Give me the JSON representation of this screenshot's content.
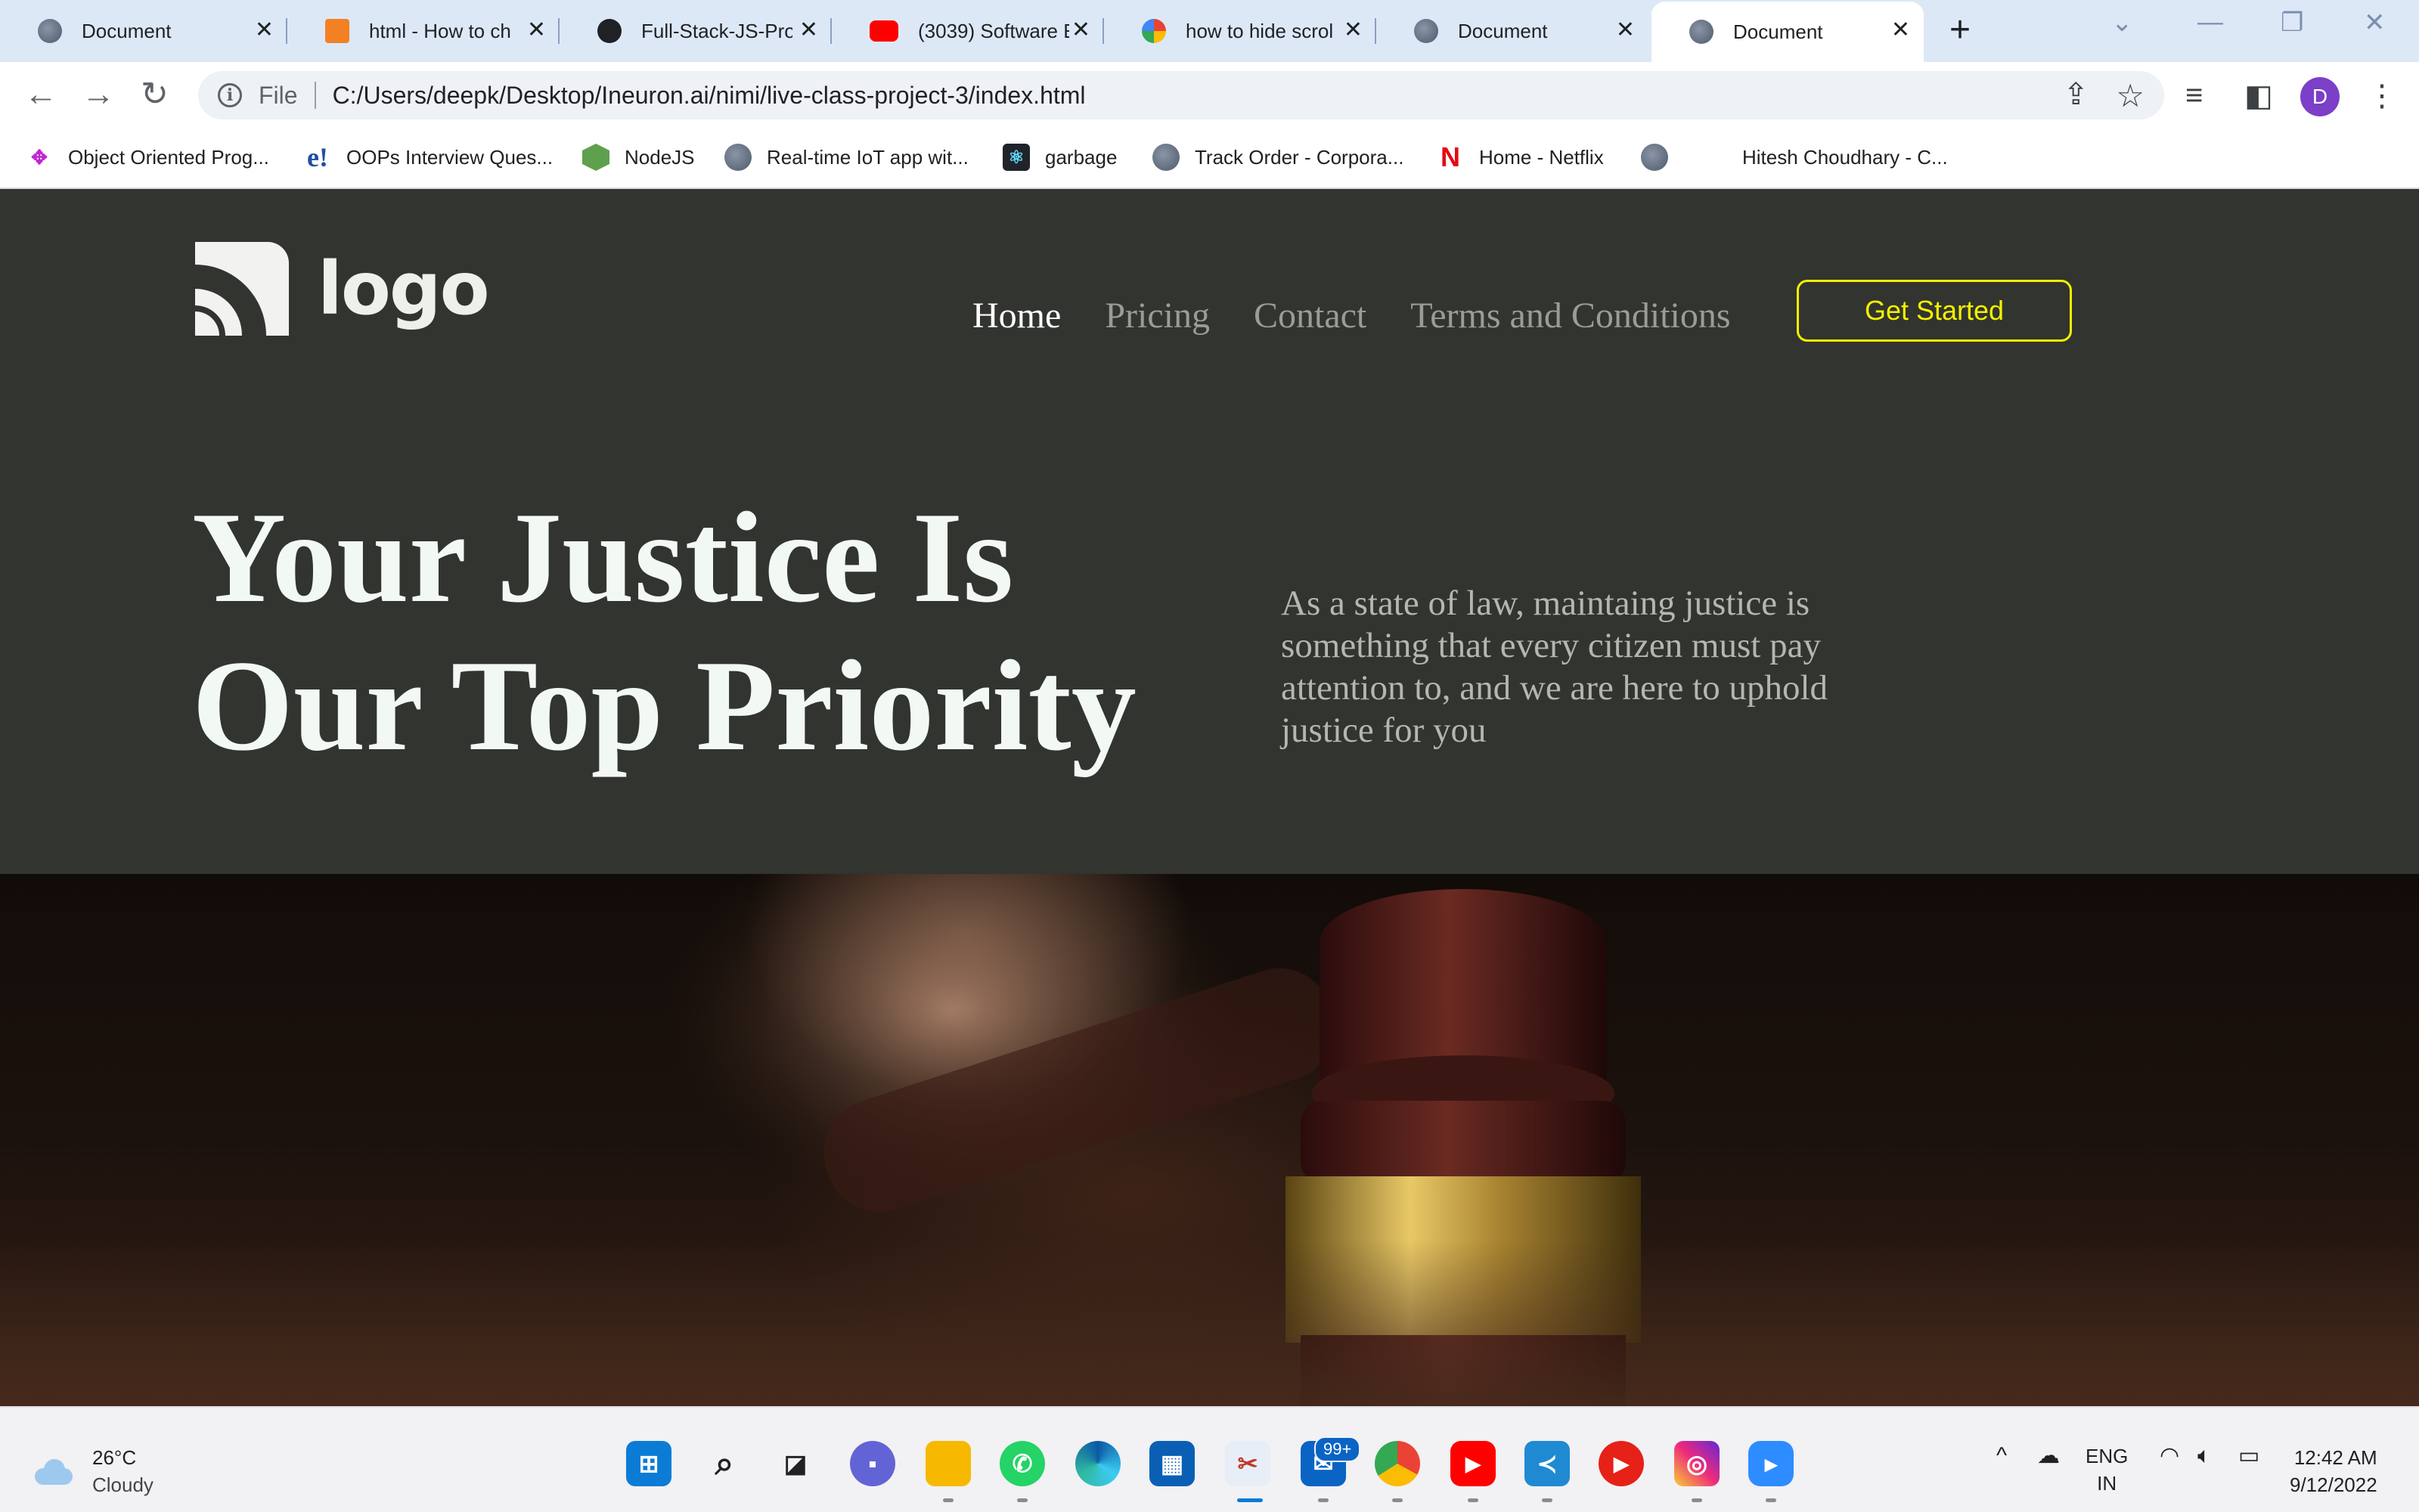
{
  "browser": {
    "tabs": [
      {
        "title": "Document",
        "icon": "globe-icon"
      },
      {
        "title": "html - How to ch",
        "icon": "stackoverflow-icon"
      },
      {
        "title": "Full-Stack-JS-Proj",
        "icon": "github-icon"
      },
      {
        "title": "(3039) Software E",
        "icon": "youtube-icon"
      },
      {
        "title": "how to hide scrol",
        "icon": "google-icon"
      },
      {
        "title": "Document",
        "icon": "globe-icon"
      },
      {
        "title": "Document",
        "icon": "globe-icon",
        "active": true
      }
    ],
    "close_glyph": "✕",
    "new_tab_glyph": "+",
    "address": {
      "scheme": "File",
      "url": "C:/Users/deepk/Desktop/Ineuron.ai/nimi/live-class-project-3/index.html"
    },
    "profile_initial": "D",
    "bookmarks": [
      {
        "label": "Object Oriented Prog...",
        "icon": "puzzle-icon"
      },
      {
        "label": "OOPs Interview Ques...",
        "icon": "e-icon"
      },
      {
        "label": "NodeJS",
        "icon": "nodejs-icon"
      },
      {
        "label": "Real-time IoT app wit...",
        "icon": "globe-icon"
      },
      {
        "label": "garbage",
        "icon": "react-icon"
      },
      {
        "label": "Track Order - Corpora...",
        "icon": "globe-icon"
      },
      {
        "label": "Home - Netflix",
        "icon": "netflix-icon"
      },
      {
        "label": "",
        "icon": "globe-icon"
      },
      {
        "label": "Hitesh Choudhary - C...",
        "icon": "none"
      }
    ]
  },
  "site": {
    "logo_text": "logo",
    "nav": [
      {
        "label": "Home",
        "active": true
      },
      {
        "label": "Pricing"
      },
      {
        "label": "Contact"
      },
      {
        "label": "Terms and Conditions"
      }
    ],
    "cta_label": "Get Started",
    "hero_title_line1": "Your Justice Is",
    "hero_title_line2": "Our Top Priority",
    "hero_subtitle": "As a state of law, maintaing justice is something that every citizen must pay attention to, and we are here to uphold justice for you",
    "colors": {
      "background": "#32342f",
      "accent": "#f4f100",
      "title": "#f2f8f4"
    }
  },
  "taskbar": {
    "weather_temp": "26°C",
    "weather_desc": "Cloudy",
    "notification_badge": "99+",
    "lang_top": "ENG",
    "lang_bottom": "IN",
    "time": "12:42 AM",
    "date": "9/12/2022"
  }
}
